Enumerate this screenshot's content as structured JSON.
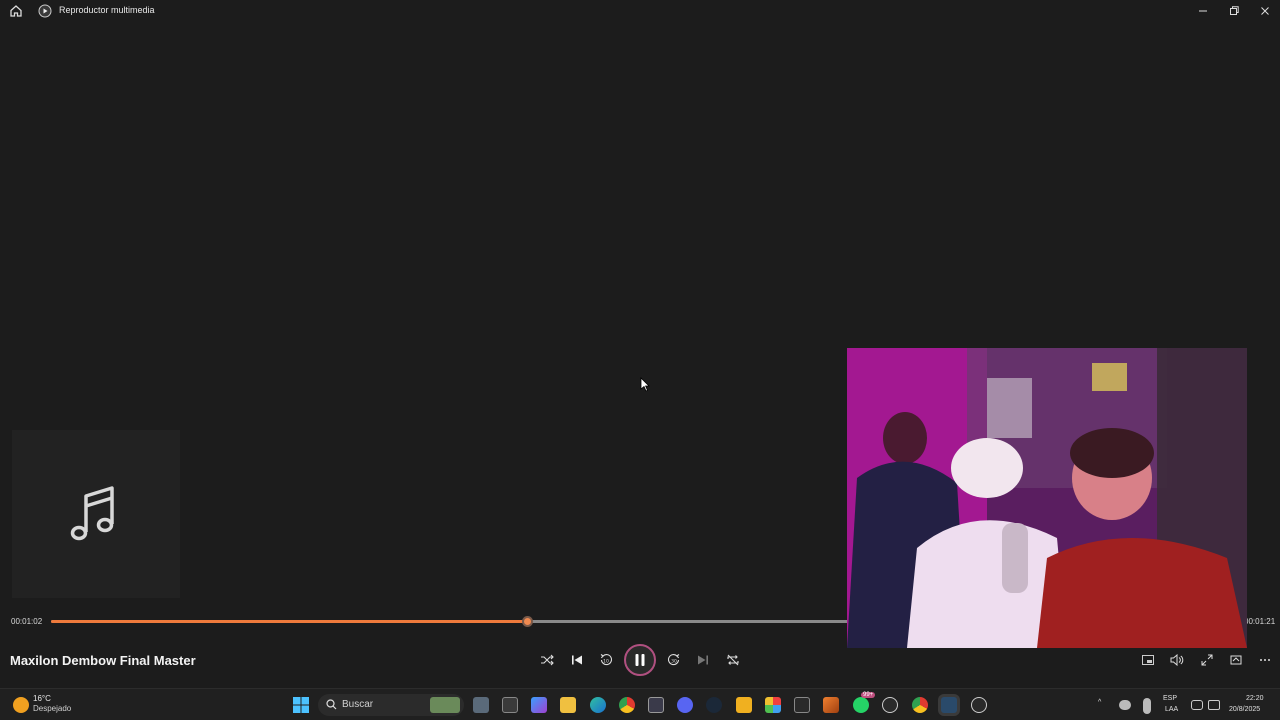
{
  "window": {
    "title": "Reproductor multimedia",
    "accent": "#ee7a3c"
  },
  "player": {
    "song_title": "Maxilon Dembow Final Master",
    "elapsed": "00:01:02",
    "total": "00:01:21",
    "progress_percent": 40,
    "state": "playing"
  },
  "taskbar": {
    "weather_temp": "16°C",
    "weather_desc": "Despejado",
    "search_placeholder": "Buscar",
    "notification_count": "99+",
    "lang": "ESP",
    "layout": "LAA",
    "time": "22:20",
    "date": "20/8/2025"
  }
}
